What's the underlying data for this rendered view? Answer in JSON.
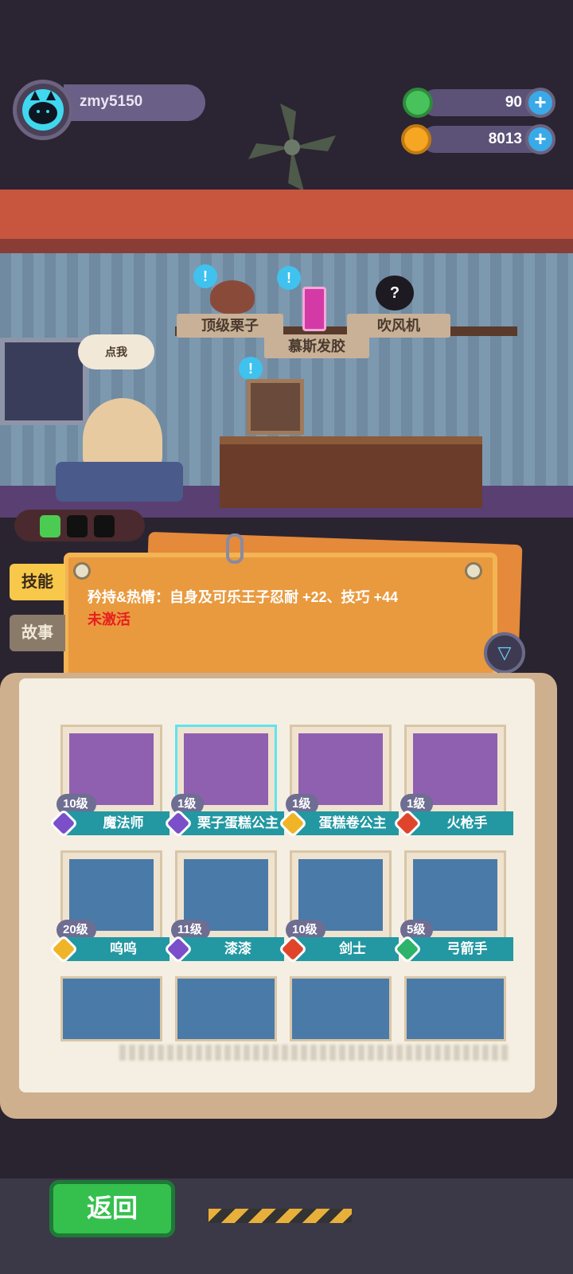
{
  "player": {
    "username": "zmy5150"
  },
  "currencies": [
    {
      "icon": "green-donut-icon",
      "value": "90",
      "color": "#48c25a"
    },
    {
      "icon": "orange-planet-coin-icon",
      "value": "8013",
      "color": "#f5a623"
    }
  ],
  "room": {
    "bubble_text": "点我",
    "signs": [
      "顶级栗子",
      "慕斯发胶",
      "吹风机"
    ]
  },
  "tabs": {
    "skill": "技能",
    "story": "故事"
  },
  "skill": {
    "text": "矜持&热情：自身及可乐王子忍耐 +22、技巧 +44",
    "status": "未激活"
  },
  "characters": [
    {
      "level": "10级",
      "name": "魔法师",
      "rarity_color": "#7a4fc9"
    },
    {
      "level": "1级",
      "name": "栗子蛋糕公主",
      "rarity_color": "#7a4fc9"
    },
    {
      "level": "1级",
      "name": "蛋糕卷公主",
      "rarity_color": "#f0b428"
    },
    {
      "level": "1级",
      "name": "火枪手",
      "rarity_color": "#e0452c"
    },
    {
      "level": "20级",
      "name": "呜呜",
      "rarity_color": "#f0b428"
    },
    {
      "level": "11级",
      "name": "漆漆",
      "rarity_color": "#7a4fc9"
    },
    {
      "level": "10级",
      "name": "剑士",
      "rarity_color": "#e0452c"
    },
    {
      "level": "5级",
      "name": "弓箭手",
      "rarity_color": "#2db36a"
    }
  ],
  "footer": {
    "back_label": "返回"
  }
}
